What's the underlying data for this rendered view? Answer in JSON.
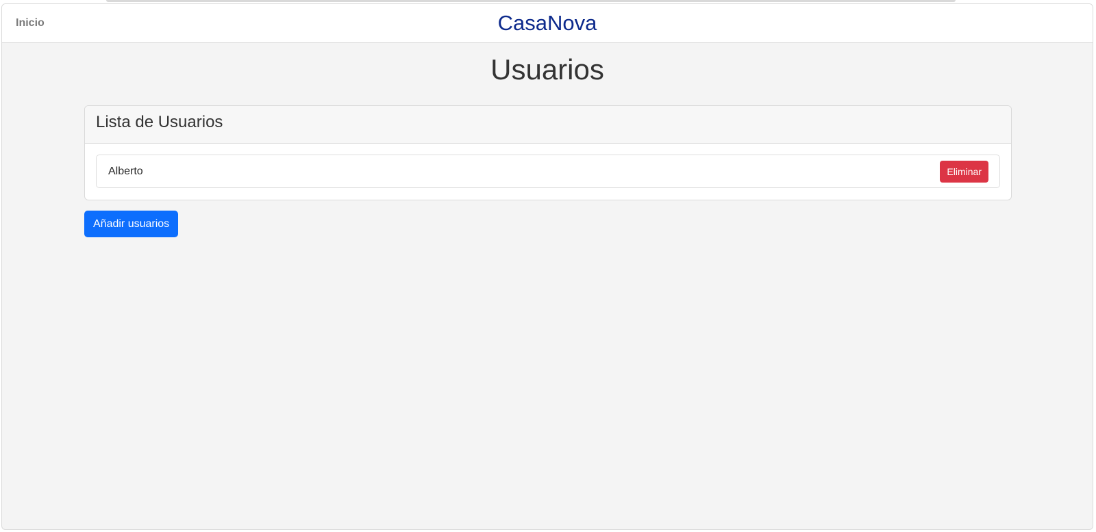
{
  "nav": {
    "home_label": "Inicio",
    "brand": "CasaNova"
  },
  "page": {
    "title": "Usuarios"
  },
  "users_card": {
    "title": "Lista de Usuarios",
    "users": [
      {
        "name": "Alberto",
        "delete_label": "Eliminar"
      }
    ]
  },
  "actions": {
    "add_users_label": "Añadir usuarios"
  },
  "colors": {
    "brand": "#0d2a8c",
    "danger": "#dc3545",
    "primary": "#0d6efd",
    "background": "#f4f4f4"
  }
}
